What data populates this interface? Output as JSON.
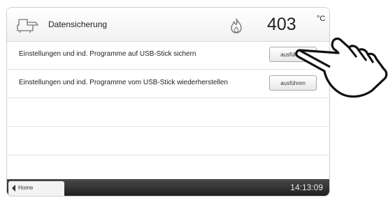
{
  "header": {
    "title": "Datensicherung",
    "temperature": "403",
    "temperature_unit": "°C",
    "icon": "usb-device-icon",
    "status_icon": "flame-icon"
  },
  "rows": [
    {
      "label": "Einstellungen und ind. Programme auf USB-Stick sichern",
      "button": "ausführen"
    },
    {
      "label": "Einstellungen und ind. Programme vom USB-Stick wiederherstellen",
      "button": "ausführen"
    }
  ],
  "footer": {
    "home_label": "Home",
    "time": "14:13:09"
  },
  "overlay": {
    "icon": "pointing-hand-icon"
  }
}
